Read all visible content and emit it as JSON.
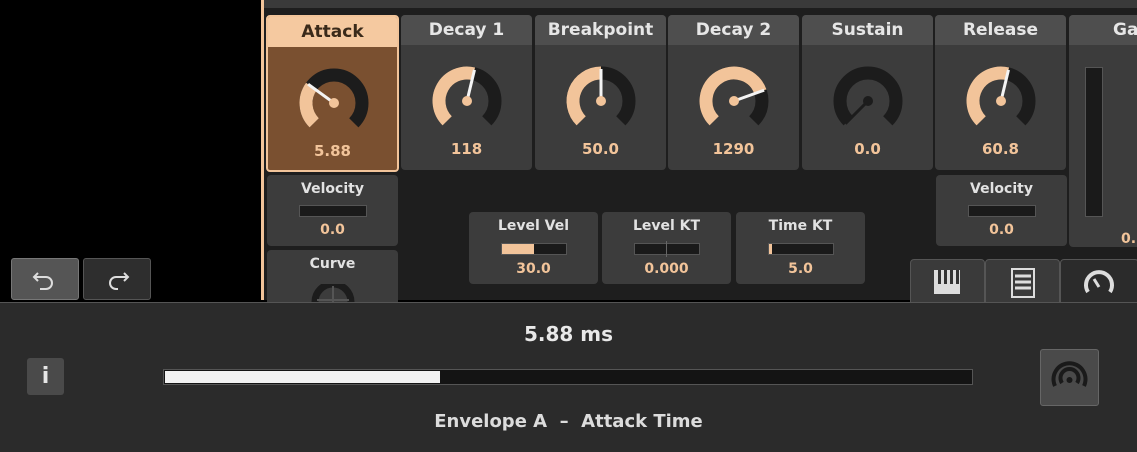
{
  "envelope": {
    "stages": [
      {
        "label": "Attack",
        "value": "5.88",
        "knob": 0.3
      },
      {
        "label": "Decay 1",
        "value": "118",
        "knob": 0.55
      },
      {
        "label": "Breakpoint",
        "value": "50.0",
        "knob": 0.5
      },
      {
        "label": "Decay 2",
        "value": "1290",
        "knob": 0.76
      },
      {
        "label": "Sustain",
        "value": "0.0",
        "knob": 0.0
      },
      {
        "label": "Release",
        "value": "60.8",
        "knob": 0.55
      },
      {
        "label": "Ga"
      }
    ],
    "gain_partial_value": "0."
  },
  "attack_mod": {
    "velocity_label": "Velocity",
    "velocity_value": "0.0",
    "curve_label": "Curve"
  },
  "release_mod": {
    "velocity_label": "Velocity",
    "velocity_value": "0.0"
  },
  "level_controls": [
    {
      "label": "Level Vel",
      "value": "30.0",
      "fill": 0.5
    },
    {
      "label": "Level KT",
      "value": "0.000",
      "fill": 0.0
    },
    {
      "label": "Time KT",
      "value": "5.0",
      "fill": 0.05
    }
  ],
  "icons": {
    "undo": "undo-icon",
    "redo": "redo-icon",
    "tabs": [
      "piano-keys-icon",
      "list-icon",
      "knob-icon"
    ],
    "info": "info-icon",
    "modulation": "modulation-icon"
  },
  "info_label": "i",
  "status": {
    "readout": "5.88 ms",
    "progress": 0.34,
    "param_name": "Envelope A  –  Attack Time"
  },
  "colors": {
    "accent": "#f2c49a",
    "active_bg": "#7a5030"
  }
}
